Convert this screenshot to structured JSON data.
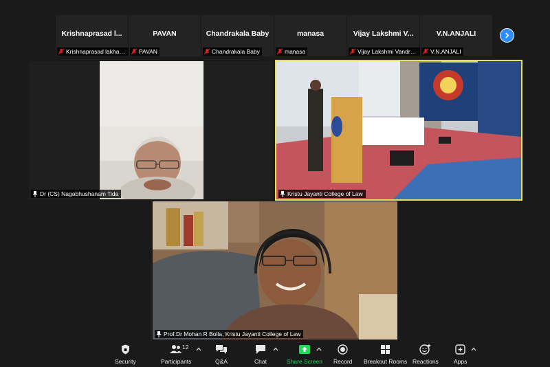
{
  "participants_strip": [
    {
      "name": "Krishnaprasad l...",
      "tag": "Krishnaprasad lakhan..."
    },
    {
      "name": "PAVAN",
      "tag": "PAVAN"
    },
    {
      "name": "Chandrakala Baby",
      "tag": "Chandrakala Baby"
    },
    {
      "name": "manasa",
      "tag": "manasa"
    },
    {
      "name": "Vijay Lakshmi V...",
      "tag": "Vijay Lakshmi Vandra..."
    },
    {
      "name": "V.N.ANJALI",
      "tag": "V.N.ANJALI"
    }
  ],
  "videos": [
    {
      "label": "Dr (CS) Nagabhushanam Tida"
    },
    {
      "label": "Kristu Jayanti College of Law"
    },
    {
      "label": "Prof.Dr Mohan R Bolla, Kristu Jayanti College of Law"
    }
  ],
  "toolbar": {
    "security": "Security",
    "participants": "Participants",
    "participants_count": "12",
    "qa": "Q&A",
    "chat": "Chat",
    "share_screen": "Share Screen",
    "record": "Record",
    "breakout_rooms": "Breakout Rooms",
    "reactions": "Reactions",
    "apps": "Apps"
  },
  "colors": {
    "accent_blue": "#2d8cff",
    "active_speaker": "#e6e05a",
    "share_green": "#23d959",
    "muted_red": "#e02828"
  }
}
